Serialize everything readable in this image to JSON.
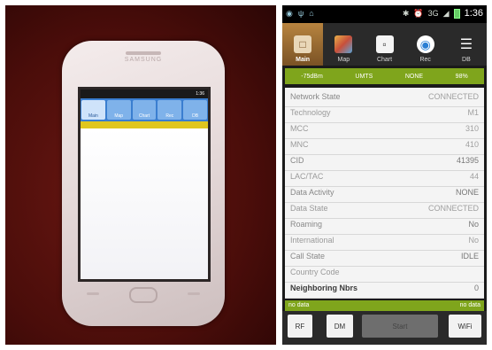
{
  "photo": {
    "phone_brand": "SAMSUNG",
    "screen_time": "1:36",
    "mini_tabs": [
      "Main",
      "Map",
      "Chart",
      "Rec",
      "DB"
    ]
  },
  "app": {
    "status": {
      "time": "1:36"
    },
    "tabs": [
      {
        "label": "Main",
        "icon": "phone-icon",
        "active": true
      },
      {
        "label": "Map",
        "icon": "map-icon",
        "active": false
      },
      {
        "label": "Chart",
        "icon": "chart-icon",
        "active": false
      },
      {
        "label": "Rec",
        "icon": "record-icon",
        "active": false
      },
      {
        "label": "DB",
        "icon": "database-icon",
        "active": false
      }
    ],
    "info_strip": [
      "-75dBm",
      "UMTS",
      "NONE",
      "98%"
    ],
    "rows": [
      {
        "label": "Network State",
        "value": "CONNECTED"
      },
      {
        "label": "Technology",
        "value": "M1"
      },
      {
        "label": "MCC",
        "value": "310"
      },
      {
        "label": "MNC",
        "value": "410"
      },
      {
        "label": "CID",
        "value": "41395"
      },
      {
        "label": "LAC/TAC",
        "value": "44"
      },
      {
        "label": "Data Activity",
        "value": "NONE"
      },
      {
        "label": "Data State",
        "value": "CONNECTED"
      },
      {
        "label": "Roaming",
        "value": "No"
      },
      {
        "label": "International",
        "value": "No"
      },
      {
        "label": "Call State",
        "value": "IDLE"
      },
      {
        "label": "Country Code",
        "value": ""
      },
      {
        "label": "Neighboring Nbrs",
        "value": "0"
      }
    ],
    "nodata_left": "no data",
    "nodata_right": "no data",
    "buttons": {
      "rf": "RF",
      "dm": "DM",
      "mid": "Start",
      "wifi": "WiFi"
    },
    "colors": {
      "accent_green": "#7fa51c",
      "active_tab": "#b8843f"
    }
  }
}
